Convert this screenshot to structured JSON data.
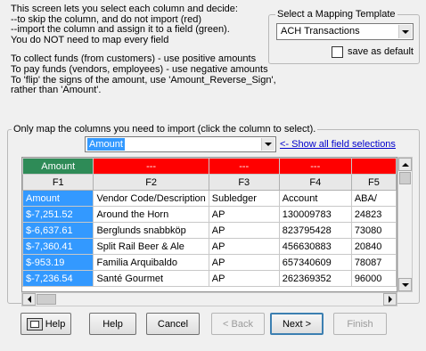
{
  "intro_lines": [
    "This screen lets you select each column and decide:",
    "--to skip the column, and do not import (red)",
    "--import the column and assign it to a field (green).",
    "You do NOT need to map every field",
    "",
    "To collect funds (from customers) - use positive amounts",
    "To pay funds (vendors, employees) - use negative amounts",
    "To 'flip' the signs of the amount, use 'Amount_Reverse_Sign',",
    "rather than 'Amount'."
  ],
  "template": {
    "legend": "Select a Mapping Template",
    "selected": "ACH Transactions",
    "save_default_label": "save as default",
    "save_default_checked": false
  },
  "mapping": {
    "legend": "Only map the columns you need to import (click the column to select).",
    "field_selected": "Amount",
    "show_all_link": "<- Show all field selections"
  },
  "grid": {
    "mapping_row": [
      {
        "label": "Amount",
        "status": "green"
      },
      {
        "label": "---",
        "status": "red"
      },
      {
        "label": "---",
        "status": "red"
      },
      {
        "label": "---",
        "status": "red"
      },
      {
        "label": "",
        "status": "red"
      }
    ],
    "headers": [
      "F1",
      "F2",
      "F3",
      "F4",
      "F5"
    ],
    "rows": [
      [
        "Amount",
        "Vendor Code/Description",
        "Subledger",
        "Account",
        "ABA/"
      ],
      [
        "$-7,251.52",
        "Around the Horn",
        "AP",
        "130009783",
        "24823"
      ],
      [
        "$-6,637.61",
        "Berglunds snabbköp",
        "AP",
        "823795428",
        "73080"
      ],
      [
        "$-7,360.41",
        "Split Rail Beer & Ale",
        "AP",
        "456630883",
        "20840"
      ],
      [
        "$-953.19",
        "Familia Arquibaldo",
        "AP",
        "657340609",
        "78087"
      ],
      [
        "$-7,236.54",
        "Santé Gourmet",
        "AP",
        "262369352",
        "96000"
      ]
    ]
  },
  "buttons": {
    "help_icon_label": "Help",
    "help": "Help",
    "cancel": "Cancel",
    "back": "< Back",
    "next": "Next >",
    "finish": "Finish"
  }
}
